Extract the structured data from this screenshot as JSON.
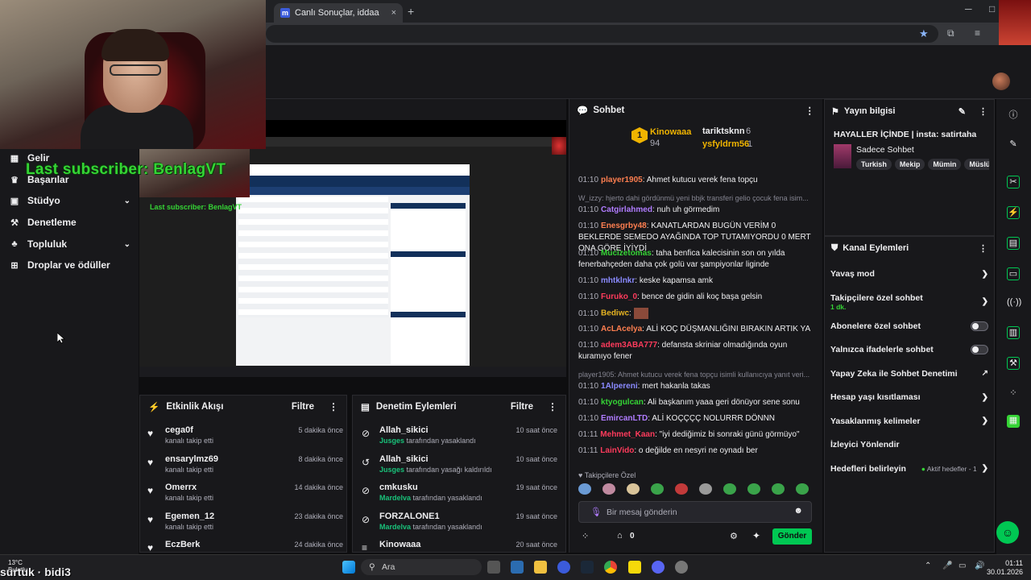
{
  "browser": {
    "tab_title": "Canlı Sonuçlar, iddaa sonuçlar",
    "new_tab": "+",
    "close": "×",
    "minimize": "─",
    "restore": "□"
  },
  "overlay": {
    "last_subscriber": "Last subscriber: BenlagVT",
    "last_subscriber_small": "Last subscriber: BenlagVT",
    "streamer_label": "surtuk · bidi3",
    "weather": "13°C",
    "weather_sub": "Bulutlu"
  },
  "nav": {
    "items": [
      {
        "label": "Gelir",
        "icon": "dollar-icon"
      },
      {
        "label": "Başarılar",
        "icon": "trophy-icon"
      },
      {
        "label": "Stüdyo",
        "icon": "studio-icon"
      },
      {
        "label": "Denetleme",
        "icon": "wrench-icon"
      },
      {
        "label": "Topluluk",
        "icon": "community-icon"
      },
      {
        "label": "Droplar ve ödüller",
        "icon": "gift-icon"
      }
    ]
  },
  "activity": {
    "title": "Etkinlik Akışı",
    "filter": "Filtre",
    "items": [
      {
        "name": "cega0f",
        "sub": "kanalı takip etti",
        "time": "5 dakika önce"
      },
      {
        "name": "ensarylmz69",
        "sub": "kanalı takip etti",
        "time": "8 dakika önce"
      },
      {
        "name": "Omerrx",
        "sub": "kanalı takip etti",
        "time": "14 dakika önce"
      },
      {
        "name": "Egemen_12",
        "sub": "kanalı takip etti",
        "time": "23 dakika önce"
      },
      {
        "name": "EczBerk",
        "sub": "",
        "time": "24 dakika önce"
      }
    ]
  },
  "moderation": {
    "title": "Denetim Eylemleri",
    "filter": "Filtre",
    "items": [
      {
        "name": "Allah_sikici",
        "mod": "Jusges",
        "action": "tarafından yasaklandı",
        "time": "10 saat önce"
      },
      {
        "name": "Allah_sikici",
        "mod": "Jusges",
        "action": "tarafından yasağı kaldırıldı",
        "time": "10 saat önce"
      },
      {
        "name": "cmkusku",
        "mod": "Mardelva",
        "action": "tarafından yasaklandı",
        "time": "19 saat önce"
      },
      {
        "name": "FORZALONE1",
        "mod": "Mardelva",
        "action": "tarafından yasaklandı",
        "time": "19 saat önce"
      },
      {
        "name": "Kinowaaa",
        "mod": "",
        "action": "",
        "time": "20 saat önce"
      }
    ]
  },
  "chat": {
    "title": "Sohbet",
    "leader": {
      "first": "Kinowaaa",
      "first_count": "94",
      "second": "tariktsknn",
      "second_count": "6",
      "third": "ysfyldrm56",
      "third_count": "1",
      "rank": "1"
    },
    "messages": [
      {
        "time": "01:10",
        "user": "player1905",
        "color": "#ff7f50",
        "text": "Ahmet kutucu verek fena topçu"
      },
      {
        "reply": "W_izzy: hjerto dahi gördünmü yeni bbjk transferi gelio çocuk fena isim..."
      },
      {
        "time": "01:10",
        "user": "Catgirlahmed",
        "color": "#b07cff",
        "text": "nuh uh görmedim"
      },
      {
        "time": "01:10",
        "user": "Enesgrby48",
        "color": "#ff7f50",
        "text": "KANATLARDAN BUGÜN VERİM 0 BEKLERDE SEMEDO AYAĞINDA TOP TUTAMIYORDU 0 MERT ONA GÖRE İYİYDİ"
      },
      {
        "time": "01:10",
        "user": "Mucizetomas",
        "color": "#35d435",
        "text": "taha benfica kalecisinin son on yılda fenerbahçeden daha çok golü var şampiyonlar liginde"
      },
      {
        "time": "01:10",
        "user": "mhtklnkr",
        "color": "#8a8aff",
        "text": "keske kapamsa amk"
      },
      {
        "time": "01:10",
        "user": "Furuko_0",
        "color": "#ff3b5c",
        "text": "bence de gidin ali koç başa gelsin"
      },
      {
        "time": "01:10",
        "user": "Bediwc",
        "color": "#e6b422",
        "text": ""
      },
      {
        "time": "01:10",
        "user": "AcLAcelya",
        "color": "#ff7f50",
        "text": "ALİ KOÇ DÜŞMANLIĞINI BIRAKIN ARTIK YA"
      },
      {
        "time": "01:10",
        "user": "adem3ABA777",
        "color": "#ff3b5c",
        "text": "defansta skriniar olmadığında oyun kuramıyo fener"
      },
      {
        "reply": "player1905: Ahmet kutucu verek fena topçu isimli kullanıcıya yanıt veri..."
      },
      {
        "time": "01:10",
        "user": "1Alpereni",
        "color": "#8a8aff",
        "text": "mert hakanla takas"
      },
      {
        "time": "01:10",
        "user": "ktyogulcan",
        "color": "#35d435",
        "text": "Ali başkanım yaaa geri dönüyor sene sonu"
      },
      {
        "time": "01:10",
        "user": "EmircanLTD",
        "color": "#b07cff",
        "text": "ALİ KOÇÇÇÇ NOLURRR DÖNNN"
      },
      {
        "time": "01:11",
        "user": "Mehmet_Kaan",
        "color": "#ff3b5c",
        "text": "\"iyi dediğimiz bi sonraki günü görmüyo\""
      },
      {
        "time": "01:11",
        "user": "LainVido",
        "color": "#ff3b5c",
        "text": "o değilde en nesyri ne oynadı ber"
      }
    ],
    "followers_only": "Takipçilere Özel",
    "placeholder": "Bir mesaj gönderin",
    "points": "0",
    "send": "Gönder"
  },
  "stream_info": {
    "title": "Yayın bilgisi",
    "stream_title": "HAYALLER İÇİNDE | insta: satirtaha",
    "category": "Sadece Sohbet",
    "tags": [
      "Turkish",
      "Mekip",
      "Mümin",
      "Müslüm"
    ]
  },
  "channel_actions": {
    "title": "Kanal Eylemleri",
    "rows": [
      {
        "label": "Yavaş mod",
        "type": "chevron"
      },
      {
        "label": "Takipçilere özel sohbet",
        "sub": "1 dk.",
        "type": "chevron"
      },
      {
        "label": "Abonelere özel sohbet",
        "type": "toggle"
      },
      {
        "label": "Yalnızca ifadelerle sohbet",
        "type": "toggle"
      },
      {
        "label": "Yapay Zeka ile Sohbet Denetimi",
        "type": "external"
      },
      {
        "label": "Hesap yaşı kısıtlaması",
        "type": "chevron"
      },
      {
        "label": "Yasaklanmış kelimeler",
        "type": "chevron"
      },
      {
        "label": "İzleyici Yönlendir",
        "type": "none"
      },
      {
        "label": "Hedefleri belirleyin",
        "type": "goal",
        "extra": "Aktif hedefler - 1"
      }
    ]
  },
  "taskbar": {
    "search": "Ara",
    "time": "01:11",
    "date": "30.01.2026",
    "overlay_name": "surtuk · bidi3"
  },
  "colors": {
    "accent": "#00c853",
    "brand_purple": "#9146ff",
    "bg": "#0e0e10",
    "panel": "#18181b"
  }
}
